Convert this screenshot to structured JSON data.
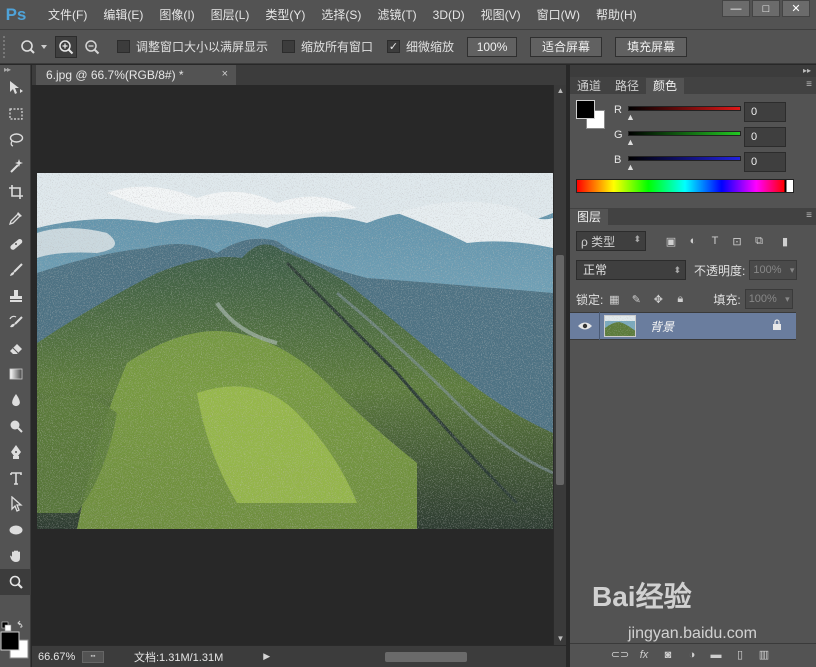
{
  "app": {
    "logo": "Ps",
    "menu": [
      "文件(F)",
      "编辑(E)",
      "图像(I)",
      "图层(L)",
      "类型(Y)",
      "选择(S)",
      "滤镜(T)",
      "3D(D)",
      "视图(V)",
      "窗口(W)",
      "帮助(H)"
    ],
    "window_controls": {
      "minimize": "—",
      "maximize": "□",
      "close": "✕"
    }
  },
  "options": {
    "resize_windows_label": "调整窗口大小以满屏显示",
    "resize_windows_checked": false,
    "zoom_all_label": "缩放所有窗口",
    "zoom_all_checked": false,
    "scrubby_zoom_label": "细微缩放",
    "scrubby_zoom_checked": true,
    "pct_button": "100%",
    "fit_screen_button": "适合屏幕",
    "fill_screen_button": "填充屏幕"
  },
  "document": {
    "tab_title": "6.jpg @ 66.7%(RGB/8#) *",
    "tab_close": "×",
    "zoom": "66.67%",
    "doc_info": "文档:1.31M/1.31M",
    "status_arrow": "▶"
  },
  "panels": {
    "top_tabs": [
      "通道",
      "路径",
      "颜色"
    ],
    "active_top_tab": 2,
    "color": {
      "channels": [
        {
          "label": "R",
          "value": "0",
          "gradient_color": "#e01818"
        },
        {
          "label": "G",
          "value": "0",
          "gradient_color": "#22c822"
        },
        {
          "label": "B",
          "value": "0",
          "gradient_color": "#2222e0"
        }
      ],
      "foreground": "#000000",
      "background": "#ffffff"
    },
    "layers": {
      "tab": "图层",
      "kind_label": "ρ 类型",
      "blend_mode": "正常",
      "opacity_label": "不透明度:",
      "opacity_value": "100%",
      "lock_label": "锁定:",
      "fill_label": "填充:",
      "fill_value": "100%",
      "items": [
        {
          "name": "背景",
          "locked": true,
          "visible": true
        }
      ]
    }
  },
  "watermark": {
    "logo": "Bai经验",
    "url": "jingyan.baidu.com"
  }
}
